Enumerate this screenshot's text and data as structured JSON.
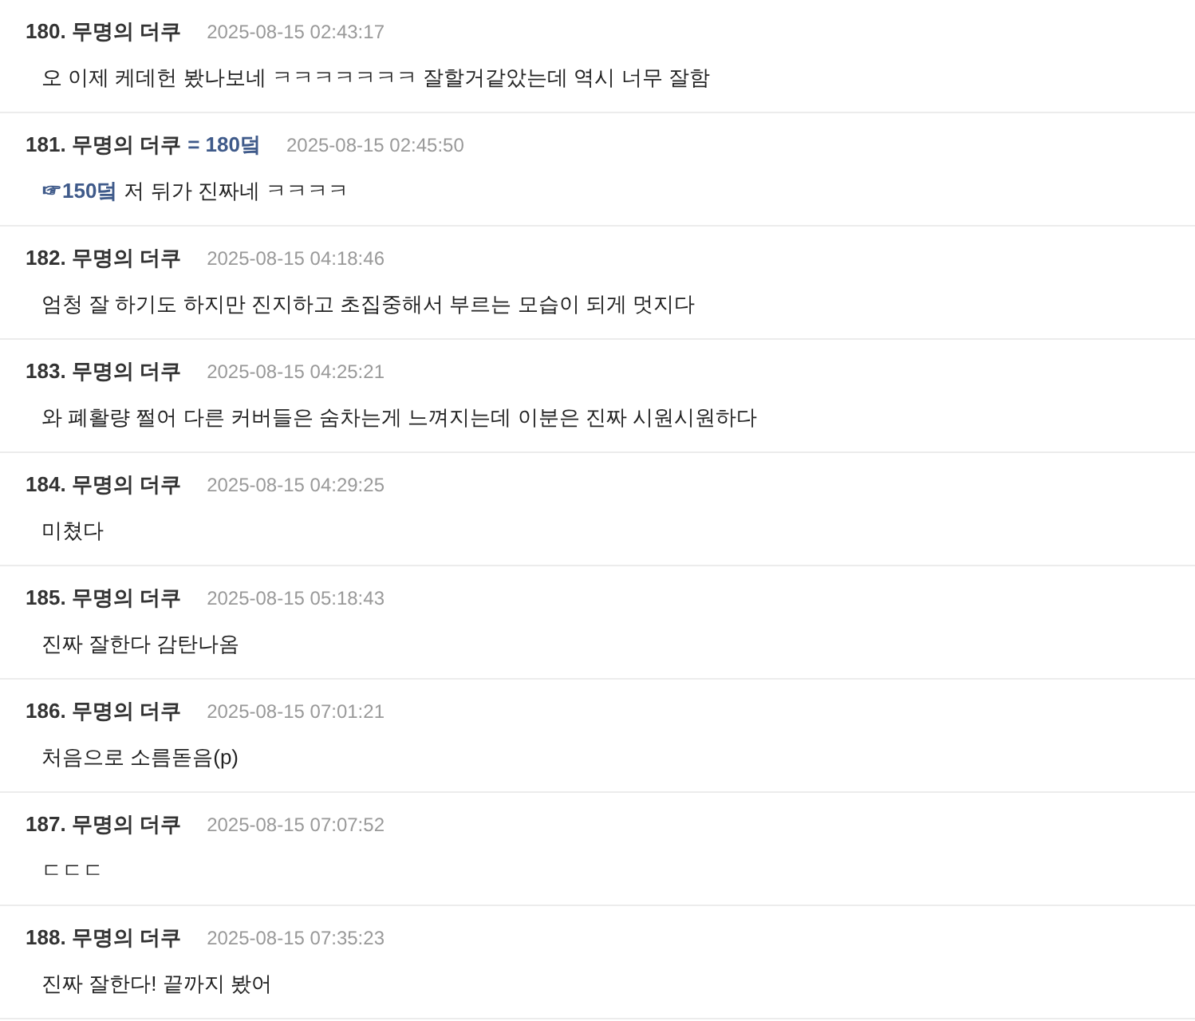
{
  "comments": [
    {
      "number": "180.",
      "author": "무명의 더쿠",
      "time": "2025-08-15 02:43:17",
      "body": "오 이제 케데헌 봤나보네 ㅋㅋㅋㅋㅋㅋㅋ 잘할거같았는데 역시 너무 잘함"
    },
    {
      "number": "181.",
      "author": "무명의 더쿠",
      "reply_to": "= 180덬",
      "time": "2025-08-15 02:45:50",
      "mention": "☞150덬",
      "body": "저 뒤가 진짜네 ㅋㅋㅋㅋ"
    },
    {
      "number": "182.",
      "author": "무명의 더쿠",
      "time": "2025-08-15 04:18:46",
      "body": "엄청 잘 하기도 하지만 진지하고 초집중해서 부르는 모습이 되게 멋지다"
    },
    {
      "number": "183.",
      "author": "무명의 더쿠",
      "time": "2025-08-15 04:25:21",
      "body": "와 폐활량 쩔어 다른 커버들은 숨차는게 느껴지는데 이분은 진짜 시원시원하다"
    },
    {
      "number": "184.",
      "author": "무명의 더쿠",
      "time": "2025-08-15 04:29:25",
      "body": "미쳤다"
    },
    {
      "number": "185.",
      "author": "무명의 더쿠",
      "time": "2025-08-15 05:18:43",
      "body": "진짜 잘한다 감탄나옴"
    },
    {
      "number": "186.",
      "author": "무명의 더쿠",
      "time": "2025-08-15 07:01:21",
      "body": "처음으로 소름돋음(p)"
    },
    {
      "number": "187.",
      "author": "무명의 더쿠",
      "time": "2025-08-15 07:07:52",
      "body": "ㄷㄷㄷ"
    },
    {
      "number": "188.",
      "author": "무명의 더쿠",
      "time": "2025-08-15 07:35:23",
      "body": "진짜 잘한다! 끝까지 봤어"
    }
  ]
}
